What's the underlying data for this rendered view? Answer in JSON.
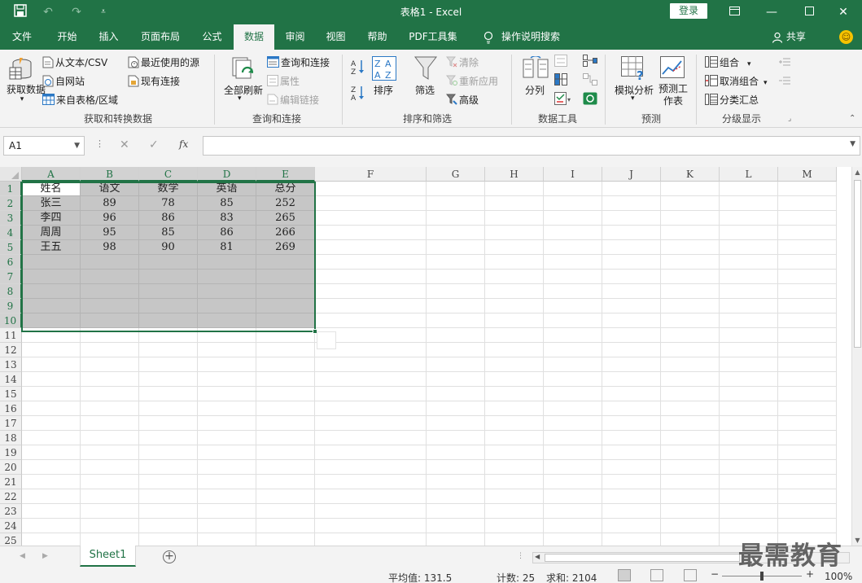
{
  "window": {
    "title": "表格1  -  Excel",
    "login": "登录"
  },
  "ribbon_tabs": [
    {
      "label": "文件"
    },
    {
      "label": "开始"
    },
    {
      "label": "插入"
    },
    {
      "label": "页面布局"
    },
    {
      "label": "公式"
    },
    {
      "label": "数据"
    },
    {
      "label": "审阅"
    },
    {
      "label": "视图"
    },
    {
      "label": "帮助"
    },
    {
      "label": "PDF工具集"
    },
    {
      "label": "操作说明搜索"
    }
  ],
  "active_tab": "数据",
  "share": "共享",
  "groups": {
    "get_data": {
      "label": "获取和转换数据",
      "big_button": "获取数据",
      "items": [
        "从文本/CSV",
        "自网站",
        "来自表格/区域",
        "最近使用的源",
        "现有连接"
      ]
    },
    "queries": {
      "label": "查询和连接",
      "big_button": "全部刷新",
      "items": [
        "查询和连接",
        "属性",
        "编辑链接"
      ]
    },
    "sort_filter": {
      "label": "排序和筛选",
      "sort": "排序",
      "filter": "筛选",
      "items": [
        "清除",
        "重新应用",
        "高级"
      ]
    },
    "data_tools": {
      "label": "数据工具",
      "split": "分列"
    },
    "forecast": {
      "label": "预测",
      "whatif": "模拟分析",
      "sheet": "预测工作表"
    },
    "outline": {
      "label": "分级显示",
      "items": [
        "组合",
        "取消组合",
        "分类汇总"
      ]
    }
  },
  "formula_bar": {
    "name_box": "A1",
    "fx": "fx",
    "formula": ""
  },
  "columns": [
    "A",
    "B",
    "C",
    "D",
    "E",
    "F",
    "G",
    "H",
    "I",
    "J",
    "K",
    "L",
    "M"
  ],
  "rows": [
    "1",
    "2",
    "3",
    "4",
    "5",
    "6",
    "7",
    "8",
    "9",
    "10",
    "11",
    "12",
    "13",
    "14",
    "15",
    "16",
    "17",
    "18",
    "19",
    "20",
    "21",
    "22",
    "23",
    "24",
    "25"
  ],
  "table": {
    "header": [
      "姓名",
      "语文",
      "数学",
      "英语",
      "总分"
    ],
    "rows": [
      [
        "张三",
        "89",
        "78",
        "85",
        "252"
      ],
      [
        "李四",
        "96",
        "86",
        "83",
        "265"
      ],
      [
        "周周",
        "95",
        "85",
        "86",
        "266"
      ],
      [
        "王五",
        "98",
        "90",
        "81",
        "269"
      ]
    ]
  },
  "sheet_tab": "Sheet1",
  "status": {
    "average": "平均值: 131.5",
    "count": "计数: 25",
    "sum": "求和: 2104",
    "zoom": "100%"
  },
  "watermark": "最需教育"
}
